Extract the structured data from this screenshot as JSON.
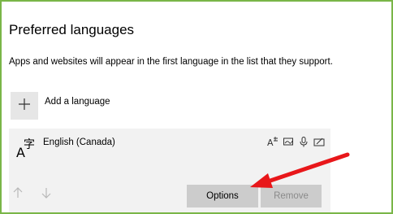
{
  "section": {
    "title": "Preferred languages",
    "description": "Apps and websites will appear in the first language in the list that they support."
  },
  "add_language": {
    "label": "Add a language",
    "icon": "plus-icon"
  },
  "language_item": {
    "name": "English (Canada)",
    "icon": "language-character-icon",
    "features": [
      "text-to-speech-icon",
      "handwriting-icon",
      "speech-recognition-icon",
      "keyboard-icon"
    ],
    "options_label": "Options",
    "remove_label": "Remove",
    "move_up_icon": "arrow-up-icon",
    "move_down_icon": "arrow-down-icon"
  },
  "colors": {
    "frame_border": "#7ab648",
    "annotation_arrow": "#e8171a",
    "card_background": "#f2f2f2",
    "button_background": "#cccccc"
  }
}
